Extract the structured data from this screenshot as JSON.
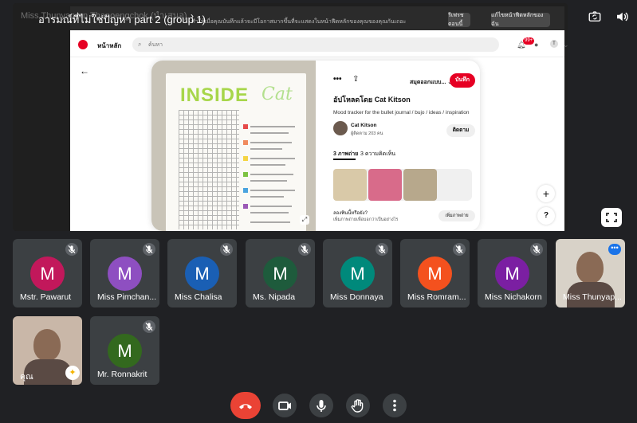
{
  "meeting": {
    "title": "อารมณ์ที่ไม่ใช่ปัญหา part 2 (group 1)",
    "title_arrow": "›",
    "presenter_ghost": "Miss Thunyaporn Thanoengchok (นำเสนอ)"
  },
  "shared_screen": {
    "extension_banner": "ทำให้เมื่อคุณบันทึกแล้วจะมีโอกาสมากขึ้นที่จะแสดงในหน้าฟีดหลักของคุณของคุณกันเถอะ",
    "banner_btn_1": "รีเฟรช ตอนนี้",
    "banner_btn_2": "แก้ไขหน้าฟีดหลักของฉัน",
    "pinterest": {
      "home_label": "หน้าหลัก",
      "search_placeholder": "ค้นหา",
      "notification_count": "99+",
      "avatar_letter": "T",
      "board_select": "สมุดออกแบบ...",
      "save_label": "บันทึก",
      "pin_title": "อัปโหลดโดย Cat Kitson",
      "pin_description": "Mood tracker for the bullet journal / bujo / ideas / inspiration",
      "creator_name": "Cat Kitson",
      "creator_followers": "ผู้ติดตาม 203 คน",
      "follow_label": "ติดตาม",
      "tab_photos": "3 ภาพถ่าย",
      "tab_comments": "3 ความคิดเห็น",
      "try_text": "ลองพินนี้หรือยัง?",
      "try_sub": "เพิ่มภาพถ่ายเพื่อบอกว่าเป็นอย่างไร",
      "add_photo_label": "เพิ่มภาพถ่าย",
      "image_word_1": "INSIDE",
      "image_word_2": "Cat"
    }
  },
  "participants": [
    {
      "name": "Mstr. Pawarut",
      "initial": "M",
      "color": "#c2185b"
    },
    {
      "name": "Miss Pimchan...",
      "initial": "M",
      "color": "#8e4fc1"
    },
    {
      "name": "Miss Chalisa",
      "initial": "M",
      "color": "#1a5fb4"
    },
    {
      "name": "Ms. Nipada",
      "initial": "M",
      "color": "#1e5b3c"
    },
    {
      "name": "Miss Donnaya",
      "initial": "M",
      "color": "#00897b"
    },
    {
      "name": "Miss Romram...",
      "initial": "M",
      "color": "#f4511e"
    },
    {
      "name": "Miss Nichakorn",
      "initial": "M",
      "color": "#7b1fa2"
    },
    {
      "name": "Miss Thunyap...",
      "initial": "",
      "color": "#d8d2c8"
    },
    {
      "name": "คุณ",
      "initial": "",
      "color": "#c9b7a8"
    },
    {
      "name": "Mr. Ronnakrit",
      "initial": "M",
      "color": "#33691e"
    }
  ],
  "icons": {
    "top_left": "chevron-down-icon",
    "camera_switch": "camera-switch-icon",
    "speaker": "speaker-icon",
    "mic_off": "mic-off-icon",
    "end_call": "end-call-icon",
    "video": "video-icon",
    "mic": "mic-icon",
    "hand": "raise-hand-icon",
    "more": "more-vert-icon"
  },
  "colors": {
    "end_call": "#ea4335",
    "pinterest_red": "#e60023",
    "tile_bg": "#3c4043"
  }
}
